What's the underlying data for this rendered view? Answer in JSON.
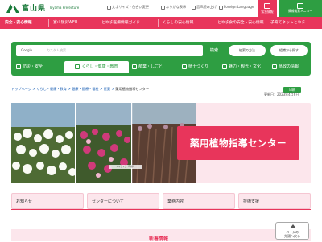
{
  "header": {
    "logo_name": "富山県",
    "logo_en": "Toyama Prefecture",
    "utility": [
      {
        "label": "文字サイズ・色合い変更"
      },
      {
        "label": "ふりがな表示"
      },
      {
        "label": "音声読み上げ"
      },
      {
        "label": "Foreign Language"
      }
    ],
    "emergency_label": "緊急情報",
    "menu_label": "情報検索メニュー"
  },
  "top_nav": [
    {
      "label": "安全・安心情報"
    },
    {
      "label": "富山防災WEB"
    },
    {
      "label": "とやま医療情報ガイド"
    },
    {
      "label": "くらしの安心情報"
    },
    {
      "label": "とやま食の安全・安心情報"
    },
    {
      "label": "子育てネットとやま"
    }
  ],
  "search": {
    "google_label": "Google",
    "placeholder": "カスタム検索",
    "button": "検索",
    "detail": "検索の方法",
    "nice_search": "組織から探す"
  },
  "categories": [
    {
      "label": "防災・安全"
    },
    {
      "label": "くらし・健康・教育"
    },
    {
      "label": "産業・しごと"
    },
    {
      "label": "県土づくり"
    },
    {
      "label": "魅力・観光・文化"
    },
    {
      "label": "県政の情報"
    }
  ],
  "breadcrumb": {
    "trail": "トップページ > くらし・健康・教育 > 健康・医療・福祉 > 医薬 > ",
    "current": "薬用植物指導センター"
  },
  "print_label": "印刷",
  "updated": "更新日：2023年4月6日",
  "hero": {
    "title": "薬用植物指導センター",
    "caption": "シャクヤク（芍薬）"
  },
  "subnav": [
    {
      "label": "お知らせ"
    },
    {
      "label": "センターについて"
    },
    {
      "label": "業務内容"
    },
    {
      "label": "技術支援"
    }
  ],
  "news_title": "新着情報",
  "to_top": "ページの\n先頭へ戻る",
  "colors": {
    "brand_green": "#2e9e42",
    "accent_pink": "#e8355b",
    "light_pink": "#fce6ec"
  }
}
